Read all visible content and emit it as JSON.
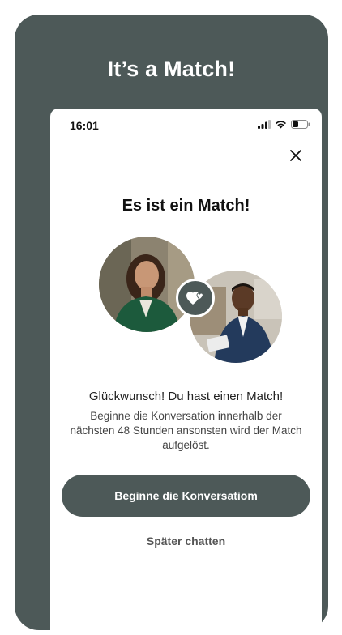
{
  "promo": {
    "title": "It’s a Match!",
    "frame_color": "#4d5958"
  },
  "status_bar": {
    "time": "16:01",
    "icons": [
      "cellular-signal-icon",
      "wifi-icon",
      "battery-icon"
    ]
  },
  "modal": {
    "close_icon": "close-icon",
    "heading": "Es ist ein Match!",
    "badge_icon": "hearts-icon",
    "congrats": "Glückwunsch! Du hast einen Match!",
    "description": "Beginne die Konversation innerhalb der nächsten 48 Stunden ansonsten wird der Match aufgelöst.",
    "primary_button": "Beginne die Konversatiom",
    "secondary_link": "Später chatten",
    "accent_color": "#4d5958"
  }
}
